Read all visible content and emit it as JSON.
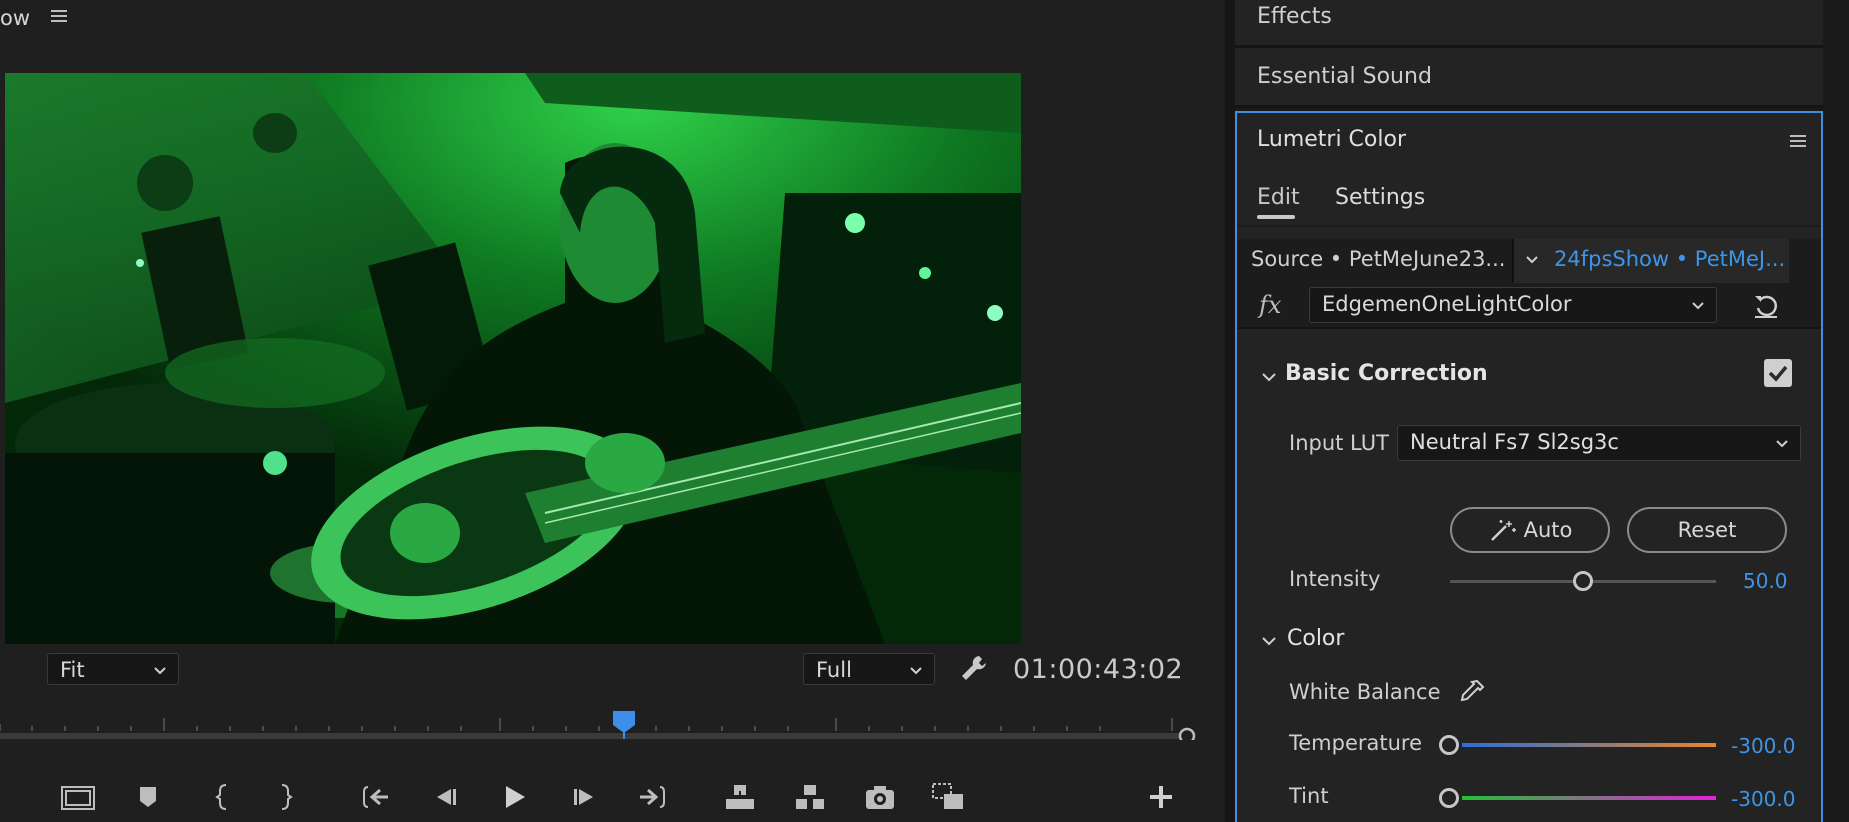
{
  "monitor": {
    "title_fragment": "ow",
    "zoom_select": "Fit",
    "quality_select": "Full",
    "timecode": "01:00:43:02",
    "playhead_position": 0.52
  },
  "transport_icons": [
    "safe-margins-icon",
    "add-marker-icon",
    "mark-in-icon",
    "mark-out-icon",
    "go-to-in-icon",
    "step-back-icon",
    "play-icon",
    "step-forward-icon",
    "go-to-out-icon",
    "lift-icon",
    "extract-icon",
    "export-frame-icon",
    "comparison-view-icon",
    "add-button-icon"
  ],
  "panels": {
    "effects": "Effects",
    "essential_sound": "Essential Sound"
  },
  "lumetri": {
    "title": "Lumetri Color",
    "tabs": {
      "edit": "Edit",
      "settings": "Settings"
    },
    "source_label": "Source • PetMeJune23...",
    "sequence_label": "24fpsShow • PetMeJ...",
    "fx_symbol": "fx",
    "effect_preset": "EdgemenOneLightColor",
    "basic_correction": {
      "heading": "Basic Correction",
      "enabled": true,
      "input_lut_label": "Input LUT",
      "input_lut_value": "Neutral Fs7 Sl2sg3c",
      "auto_label": "Auto",
      "reset_label": "Reset",
      "intensity_label": "Intensity",
      "intensity_value": "50.0",
      "intensity_level": 0.5
    },
    "color": {
      "heading": "Color",
      "white_balance_label": "White Balance",
      "temperature_label": "Temperature",
      "temperature_value": "-300.0",
      "tint_label": "Tint",
      "tint_value": "-300.0"
    },
    "accent_color": "#3d95e8"
  }
}
